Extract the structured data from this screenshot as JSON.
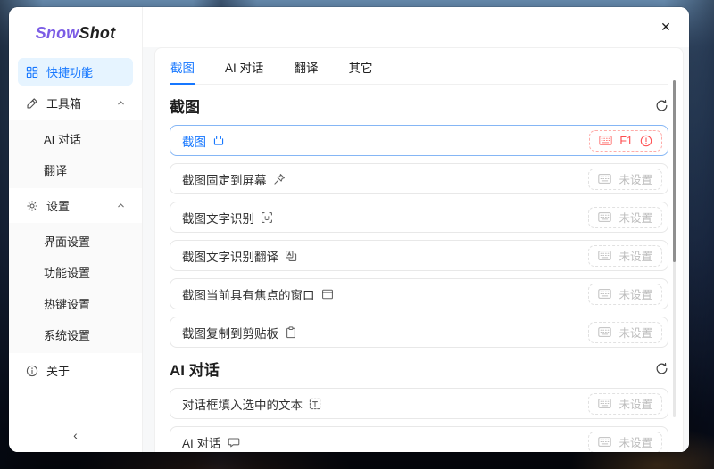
{
  "window_controls": {
    "minimize": "–",
    "close": "✕"
  },
  "sidebar": {
    "logo": {
      "snow": "Snow",
      "shot": "Shot"
    },
    "items": [
      {
        "label": "快捷功能",
        "icon": "grid-icon",
        "active": true
      },
      {
        "label": "工具箱",
        "icon": "tool-icon",
        "expanded": true
      },
      {
        "label": "AI 对话",
        "child": true
      },
      {
        "label": "翻译",
        "child": true
      },
      {
        "label": "设置",
        "icon": "gear-icon",
        "expanded": true
      },
      {
        "label": "界面设置",
        "child": true
      },
      {
        "label": "功能设置",
        "child": true
      },
      {
        "label": "热键设置",
        "child": true
      },
      {
        "label": "系统设置",
        "child": true
      },
      {
        "label": "关于",
        "icon": "info-icon"
      }
    ],
    "collapse_glyph": "‹"
  },
  "tabs": [
    {
      "label": "截图",
      "active": true
    },
    {
      "label": "AI 对话"
    },
    {
      "label": "翻译"
    },
    {
      "label": "其它"
    }
  ],
  "sections": [
    {
      "title": "截图",
      "rows": [
        {
          "label": "截图",
          "icon": "screenshot-icon",
          "hotkey": "F1",
          "status": "error",
          "selected": true
        },
        {
          "label": "截图固定到屏幕",
          "icon": "pin-icon",
          "hotkey": "未设置",
          "status": "unset"
        },
        {
          "label": "截图文字识别",
          "icon": "ocr-icon",
          "hotkey": "未设置",
          "status": "unset"
        },
        {
          "label": "截图文字识别翻译",
          "icon": "ocr-translate-icon",
          "hotkey": "未设置",
          "status": "unset"
        },
        {
          "label": "截图当前具有焦点的窗口",
          "icon": "focused-window-icon",
          "hotkey": "未设置",
          "status": "unset"
        },
        {
          "label": "截图复制到剪贴板",
          "icon": "clipboard-icon",
          "hotkey": "未设置",
          "status": "unset"
        }
      ]
    },
    {
      "title": "AI 对话",
      "rows": [
        {
          "label": "对话框填入选中的文本",
          "icon": "text-select-icon",
          "hotkey": "未设置",
          "status": "unset"
        },
        {
          "label": "AI 对话",
          "icon": "chat-icon",
          "hotkey": "未设置",
          "status": "unset"
        }
      ]
    }
  ],
  "colors": {
    "accent": "#1677ff",
    "error": "#ff4d4f",
    "logo_purple": "#7b5ce5",
    "selected_border": "#85b6f5"
  }
}
